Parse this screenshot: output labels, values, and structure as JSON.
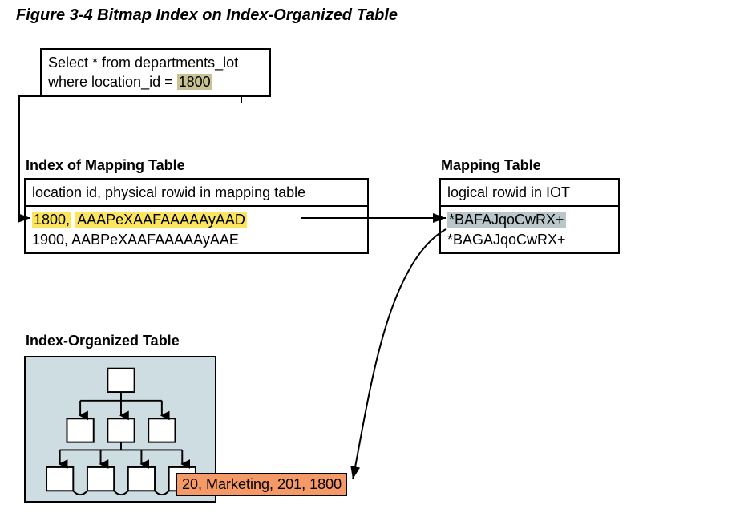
{
  "figure_title": "Figure 3-4 Bitmap Index on Index-Organized Table",
  "sql": {
    "line1_pre": "Select * from departments_lot",
    "line2_pre": "where location_id = ",
    "line2_hl": "1800"
  },
  "index_mapping": {
    "heading": "Index of Mapping Table",
    "subheading": "location id, physical rowid in mapping table",
    "rows": [
      {
        "key_hl": "1800,",
        "rowid_hl": "AAAPeXAAFAAAAAyAAD"
      },
      {
        "key": "1900,",
        "rowid": "AABPeXAAFAAAAAyAAE"
      }
    ]
  },
  "mapping_table": {
    "heading": "Mapping Table",
    "subheading": "logical rowid in IOT",
    "rows": [
      {
        "hl": "*BAFAJqoCwRX+"
      },
      {
        "plain": "*BAGAJqoCwRX+"
      }
    ]
  },
  "iot": {
    "heading": "Index-Organized Table",
    "callout": "20, Marketing, 201, 1800"
  }
}
